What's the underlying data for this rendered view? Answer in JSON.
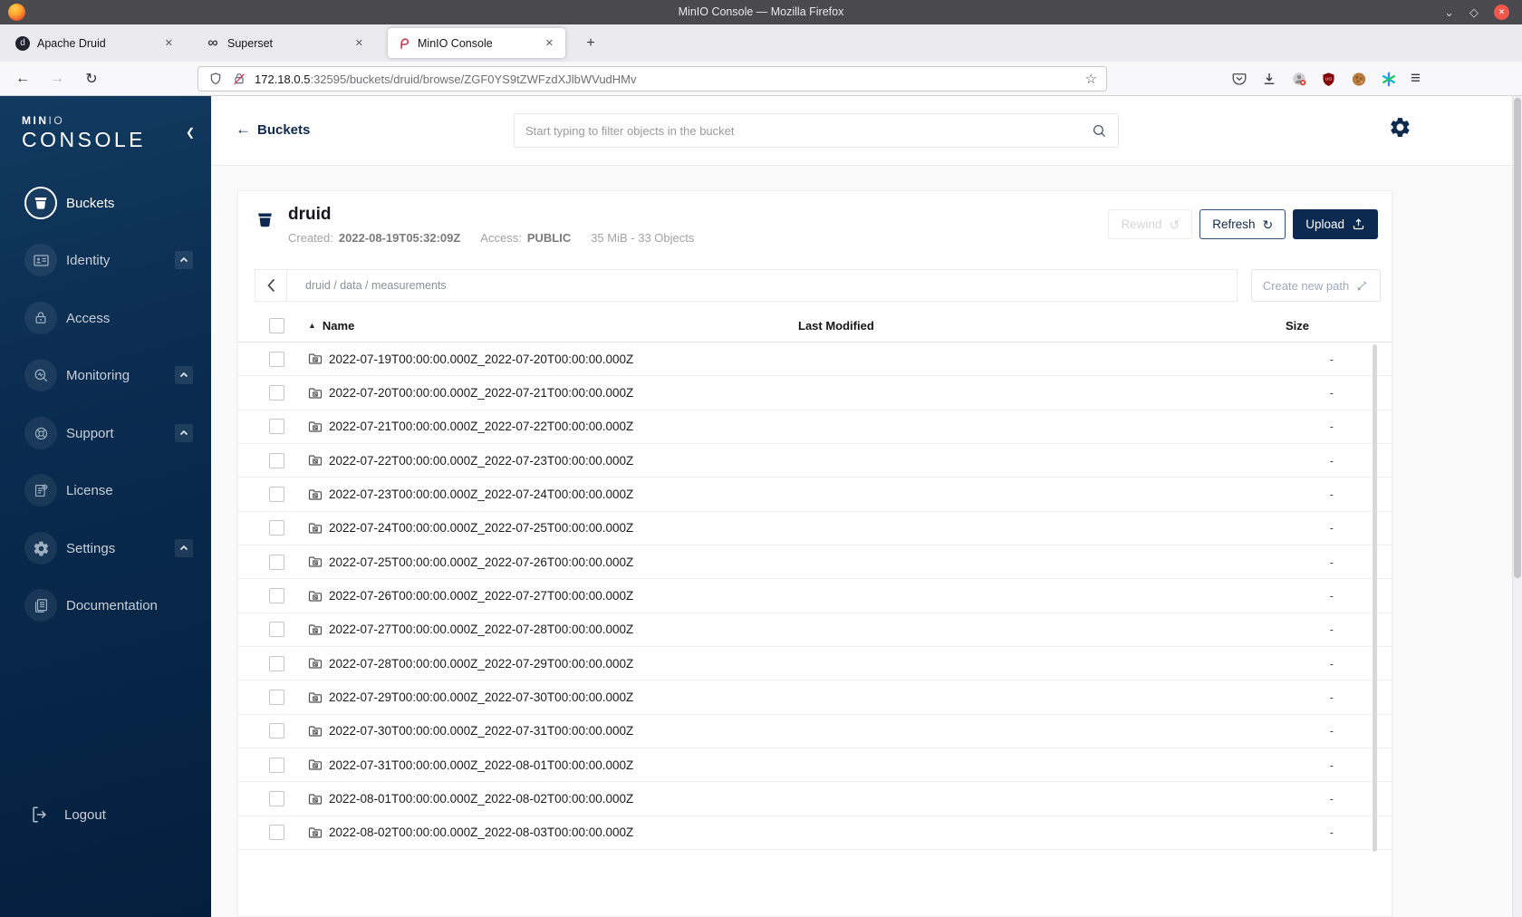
{
  "window": {
    "title": "MinIO Console — Mozilla Firefox"
  },
  "browser": {
    "tabs": [
      {
        "label": "Apache Druid"
      },
      {
        "label": "Superset"
      },
      {
        "label": "MinIO Console"
      }
    ],
    "url": {
      "host": "172.18.0.5",
      "rest": ":32595/buckets/druid/browse/ZGF0YS9tZWFzdXJlbWVudHMv"
    }
  },
  "icons": {
    "window_minimize": "⌄",
    "window_maximize": "◇",
    "window_close": "✕",
    "tab_close": "✕",
    "new_tab": "+",
    "superset_infinity": "∞",
    "druid_letter": "d",
    "nav_back": "←",
    "nav_forward": "→",
    "reload": "↻",
    "star": "☆",
    "hamburger": "≡",
    "sidebar_collapse": "❮",
    "back_arrow": "←",
    "rewind": "↺",
    "refresh": "↻",
    "sort_asc": "▲"
  },
  "sidebar": {
    "brand_bold": "MIN",
    "brand_light": "IO",
    "brand_word": "CONSOLE",
    "items": [
      {
        "label": "Buckets"
      },
      {
        "label": "Identity"
      },
      {
        "label": "Access"
      },
      {
        "label": "Monitoring"
      },
      {
        "label": "Support"
      },
      {
        "label": "License"
      },
      {
        "label": "Settings"
      },
      {
        "label": "Documentation"
      }
    ],
    "logout_label": "Logout"
  },
  "header": {
    "back_label": "Buckets",
    "search_placeholder": "Start typing to filter objects in the bucket"
  },
  "bucket": {
    "name": "druid",
    "created_label": "Created:",
    "created_value": "2022-08-19T05:32:09Z",
    "access_label": "Access:",
    "access_value": "PUBLIC",
    "usage": "35 MiB - 33 Objects"
  },
  "toolbar": {
    "rewind_label": "Rewind",
    "refresh_label": "Refresh",
    "upload_label": "Upload",
    "create_path_label": "Create new path"
  },
  "breadcrumb": {
    "path": "druid / data / measurements"
  },
  "table": {
    "headers": {
      "name": "Name",
      "last_modified": "Last Modified",
      "size": "Size"
    },
    "rows": [
      {
        "name": "2022-07-19T00:00:00.000Z_2022-07-20T00:00:00.000Z",
        "size": "-"
      },
      {
        "name": "2022-07-20T00:00:00.000Z_2022-07-21T00:00:00.000Z",
        "size": "-"
      },
      {
        "name": "2022-07-21T00:00:00.000Z_2022-07-22T00:00:00.000Z",
        "size": "-"
      },
      {
        "name": "2022-07-22T00:00:00.000Z_2022-07-23T00:00:00.000Z",
        "size": "-"
      },
      {
        "name": "2022-07-23T00:00:00.000Z_2022-07-24T00:00:00.000Z",
        "size": "-"
      },
      {
        "name": "2022-07-24T00:00:00.000Z_2022-07-25T00:00:00.000Z",
        "size": "-"
      },
      {
        "name": "2022-07-25T00:00:00.000Z_2022-07-26T00:00:00.000Z",
        "size": "-"
      },
      {
        "name": "2022-07-26T00:00:00.000Z_2022-07-27T00:00:00.000Z",
        "size": "-"
      },
      {
        "name": "2022-07-27T00:00:00.000Z_2022-07-28T00:00:00.000Z",
        "size": "-"
      },
      {
        "name": "2022-07-28T00:00:00.000Z_2022-07-29T00:00:00.000Z",
        "size": "-"
      },
      {
        "name": "2022-07-29T00:00:00.000Z_2022-07-30T00:00:00.000Z",
        "size": "-"
      },
      {
        "name": "2022-07-30T00:00:00.000Z_2022-07-31T00:00:00.000Z",
        "size": "-"
      },
      {
        "name": "2022-07-31T00:00:00.000Z_2022-08-01T00:00:00.000Z",
        "size": "-"
      },
      {
        "name": "2022-08-01T00:00:00.000Z_2022-08-02T00:00:00.000Z",
        "size": "-"
      },
      {
        "name": "2022-08-02T00:00:00.000Z_2022-08-03T00:00:00.000Z",
        "size": "-"
      }
    ]
  },
  "colors": {
    "navy": "#0C2A51",
    "sidebar_top": "#123A60",
    "sidebar_bottom": "#041F3E",
    "close_button": "#F2574B",
    "ublock_red": "#800006"
  }
}
